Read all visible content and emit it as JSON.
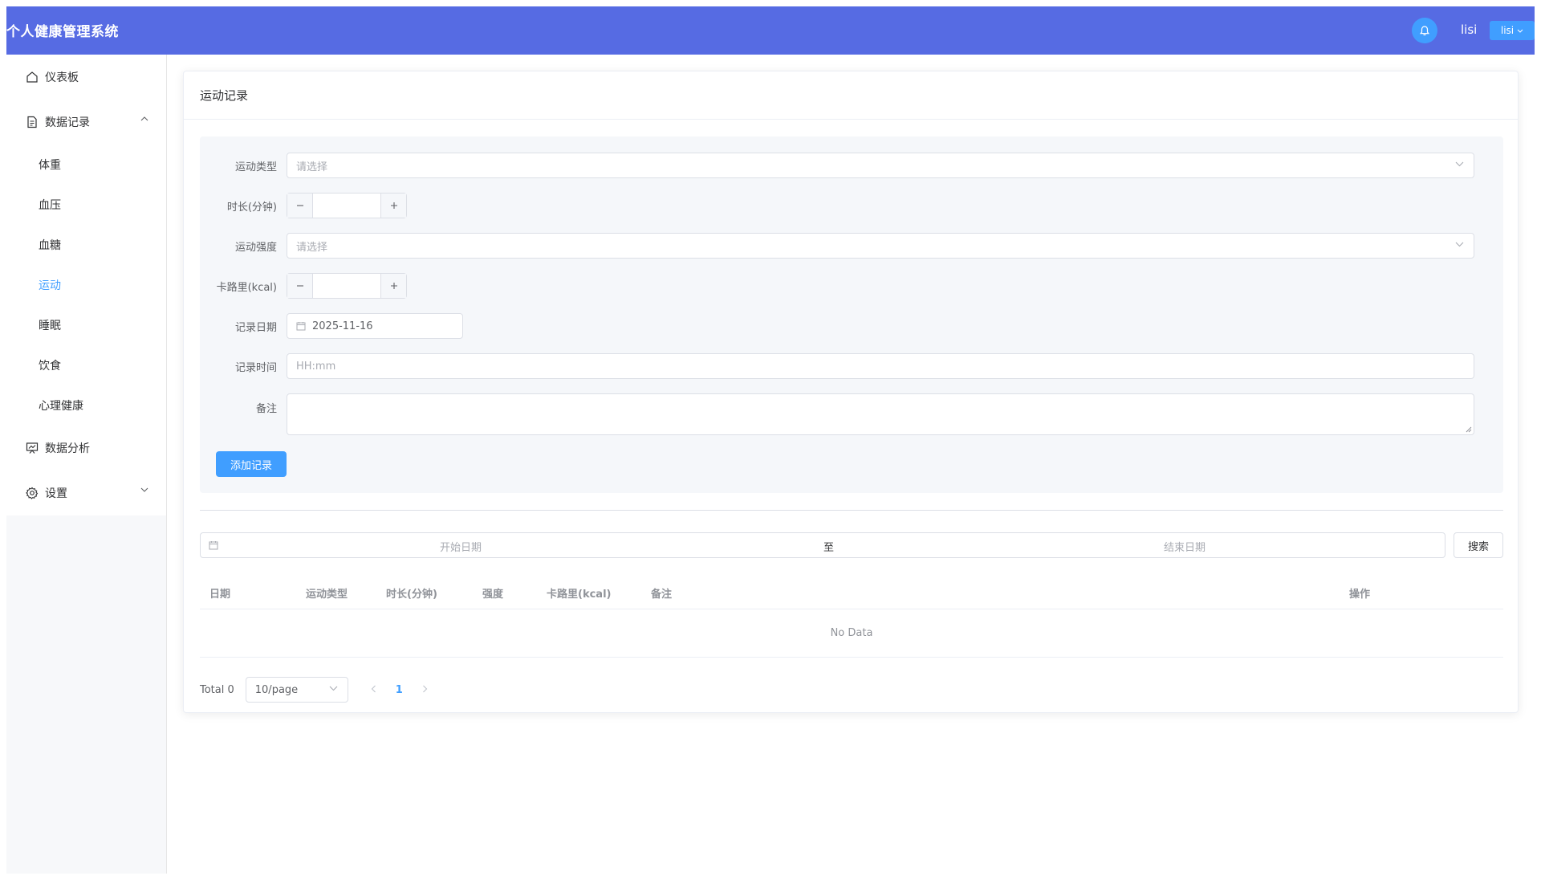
{
  "header": {
    "title": "个人健康管理系统",
    "user_name": "lisi",
    "user_button": "lisi"
  },
  "sidebar": {
    "items": [
      {
        "label": "仪表板",
        "icon": "home-icon"
      },
      {
        "label": "数据记录",
        "icon": "document-icon"
      },
      {
        "label": "数据分析",
        "icon": "chart-board-icon"
      },
      {
        "label": "设置",
        "icon": "gear-icon"
      }
    ],
    "sub_items": [
      {
        "label": "体重"
      },
      {
        "label": "血压"
      },
      {
        "label": "血糖"
      },
      {
        "label": "运动"
      },
      {
        "label": "睡眠"
      },
      {
        "label": "饮食"
      },
      {
        "label": "心理健康"
      }
    ],
    "active_sub": "运动"
  },
  "card": {
    "title": "运动记录"
  },
  "form": {
    "type_label": "运动类型",
    "type_placeholder": "请选择",
    "duration_label": "时长(分钟)",
    "intensity_label": "运动强度",
    "intensity_placeholder": "请选择",
    "calories_label": "卡路里(kcal)",
    "date_label": "记录日期",
    "date_value": "2025-11-16",
    "time_label": "记录时间",
    "time_placeholder": "HH:mm",
    "note_label": "备注",
    "submit_label": "添加记录"
  },
  "filter": {
    "start_placeholder": "开始日期",
    "separator": "至",
    "end_placeholder": "结束日期",
    "search_label": "搜索"
  },
  "table": {
    "columns": [
      "日期",
      "运动类型",
      "时长(分钟)",
      "强度",
      "卡路里(kcal)",
      "备注",
      "操作"
    ],
    "empty_text": "No Data"
  },
  "pagination": {
    "total": "Total 0",
    "page_size": "10/page",
    "current_page": "1"
  },
  "colors": {
    "header_bg": "#566be3",
    "primary": "#409eff",
    "form_bg": "#f5f7fa"
  }
}
